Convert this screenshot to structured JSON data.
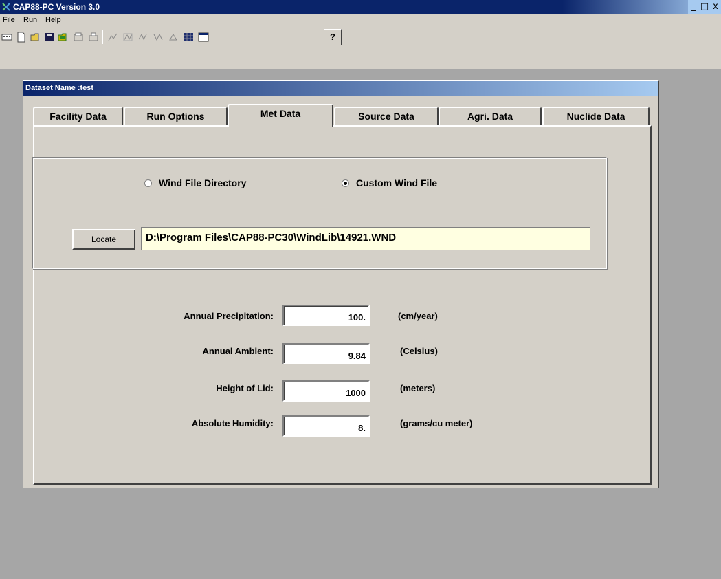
{
  "window": {
    "title": "CAP88-PC Version 3.0",
    "controls": [
      "_",
      "□",
      "x"
    ]
  },
  "menu": [
    "File",
    "Run",
    "Help"
  ],
  "toolbar": {
    "help_label": "?"
  },
  "dataset": {
    "title": "Dataset Name :test"
  },
  "tabs": [
    {
      "label": "Facility Data",
      "active": false
    },
    {
      "label": "Run Options",
      "active": false
    },
    {
      "label": "Met Data",
      "active": true
    },
    {
      "label": "Source Data",
      "active": false
    },
    {
      "label": "Agri. Data",
      "active": false
    },
    {
      "label": "Nuclide Data",
      "active": false
    }
  ],
  "wind": {
    "option_directory": "Wind File Directory",
    "option_custom": "Custom Wind File",
    "selected": "custom",
    "locate_label": "Locate",
    "path": "D:\\Program Files\\CAP88-PC30\\WindLib\\14921.WND"
  },
  "met": {
    "precipitation": {
      "label": "Annual Precipitation:",
      "value": "100.",
      "unit": "(cm/year)"
    },
    "ambient": {
      "label": "Annual Ambient:",
      "value": "9.84",
      "unit": "(Celsius)"
    },
    "lid": {
      "label": "Height of Lid:",
      "value": "1000",
      "unit": "(meters)"
    },
    "humidity": {
      "label": "Absolute Humidity:",
      "value": "8.",
      "unit": "(grams/cu meter)"
    }
  },
  "colors": {
    "titlebar": "#0a246a",
    "face": "#d4d0c8",
    "workspace": "#a6a6a6",
    "path_field": "#ffffe1"
  }
}
